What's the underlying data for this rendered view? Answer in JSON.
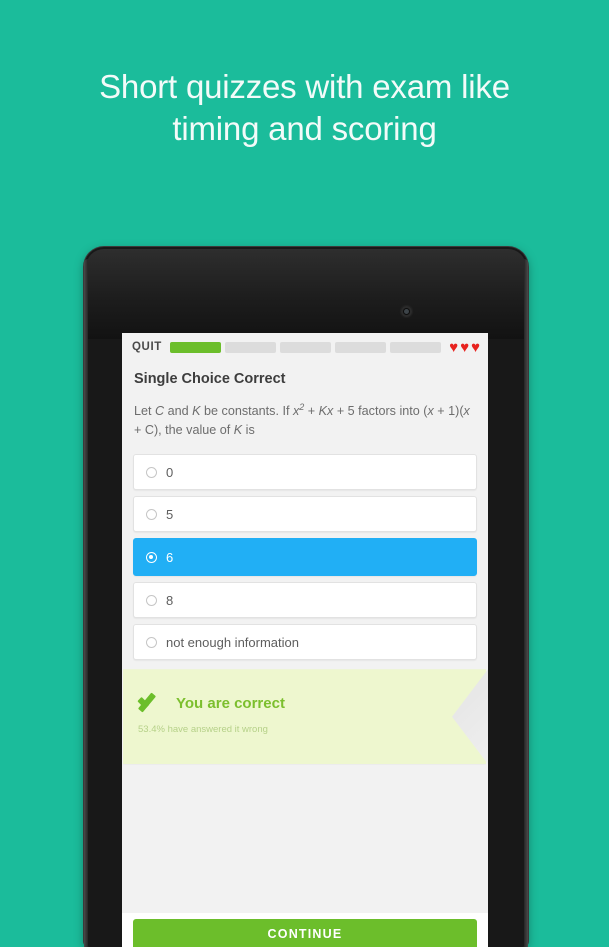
{
  "headline": {
    "line1": "Short quizzes with exam like",
    "line2": "timing and scoring"
  },
  "colors": {
    "background_teal": "#1BBC9B",
    "progress_green": "#6CBE2B",
    "selected_blue": "#21AFF5",
    "heart_red": "#E8231F",
    "ribbon_bg": "#EEF7CF",
    "correct_green": "#7CBF2E"
  },
  "app": {
    "topbar": {
      "quit_label": "QUIT",
      "progress_segments": 5,
      "progress_filled": 1,
      "hearts": [
        "heart",
        "heart",
        "heart"
      ],
      "heart_glyph": "♥"
    },
    "question": {
      "type_label": "Single Choice Correct",
      "text_plain": "Let C and K be constants. If x2 + Kx + 5 factors into (x + 1)(x + C), the value of K is",
      "parts": {
        "p1": "Let ",
        "var_c": "C",
        "p2": " and ",
        "var_k": "K",
        "p3": " be constants. If ",
        "var_x1": "x",
        "sup2": "2",
        "p4": " + ",
        "var_k2": "K",
        "var_x2": "x",
        "p5": " + 5 factors into (",
        "var_x3": "x",
        "p6": " + 1)(",
        "var_x4": "x",
        "p7": " + C), the value of ",
        "var_k3": "K",
        "p8": " is"
      }
    },
    "options": [
      {
        "label": "0",
        "selected": false
      },
      {
        "label": "5",
        "selected": false
      },
      {
        "label": "6",
        "selected": true
      },
      {
        "label": "8",
        "selected": false
      },
      {
        "label": "not enough information",
        "selected": false
      }
    ],
    "feedback": {
      "icon": "check-icon",
      "title": "You are correct",
      "stat": "53.4% have answered it wrong"
    },
    "continue_label": "CONTINUE"
  }
}
